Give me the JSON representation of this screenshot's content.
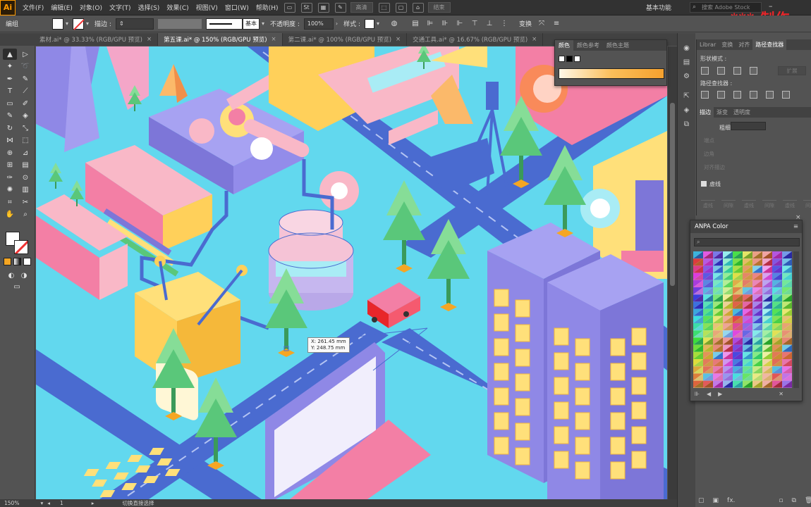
{
  "app": {
    "logo": "Ai"
  },
  "menu": [
    "文件(F)",
    "编辑(E)",
    "对象(O)",
    "文字(T)",
    "选择(S)",
    "效果(C)",
    "视图(V)",
    "窗口(W)",
    "帮助(H)"
  ],
  "menubar_buttons": {
    "st_icon": "St",
    "clear_label": "高清",
    "end_label": "结束"
  },
  "workspace": "基本功能",
  "search_stock_placeholder": "搜索 Adobe Stock",
  "watermark": "*** 制作",
  "control": {
    "group_label": "编组",
    "stroke_label": "描边 :",
    "stroke_style": "基本",
    "opacity_label": "不透明度 :",
    "opacity_value": "100%",
    "style_label": "样式 :",
    "transform_label": "变换"
  },
  "tabs": [
    {
      "label": "素材.ai* @ 33.33% (RGB/GPU 预览)",
      "active": false
    },
    {
      "label": "第五课.ai* @ 150% (RGB/GPU 预览)",
      "active": true
    },
    {
      "label": "第二课.ai* @ 100% (RGB/GPU 预览)",
      "active": false
    },
    {
      "label": "交通工具.ai* @ 16.67% (RGB/GPU 预览)",
      "active": false
    }
  ],
  "readout": {
    "x": "X: 261.45 mm",
    "y": "Y: 248.75 mm"
  },
  "status": {
    "zoom": "150%",
    "page": "1",
    "mode": "切换直接选择"
  },
  "color_panel": {
    "tabs": [
      "颜色",
      "颜色参考",
      "颜色主题"
    ]
  },
  "pathfinder_panel": {
    "tabs": [
      "Librar",
      "变换",
      "对齐",
      "路径查找器"
    ],
    "shape_modes": "形状模式 :",
    "pathfinders": "路径查找器 :",
    "expand": "扩展"
  },
  "stroke_panel": {
    "tabs": [
      "描边",
      "渐变",
      "透明度"
    ],
    "weight_label": "粗细 :",
    "cap_label": "端点",
    "corner_label": "边角",
    "align_label": "对齐描边",
    "dashed_label": "虚线",
    "dash_fields": [
      "虚线",
      "间隙",
      "虚线",
      "间隙",
      "虚线",
      "间隙"
    ]
  },
  "anpa": {
    "title": "ANPA Color"
  },
  "colors": {
    "cyan_bg": "#62d8ee",
    "road": "#4a6bd0",
    "purple_bldg": "#8f88e6",
    "window_yellow": "#ffe07a",
    "tree_green": "#5ac77a",
    "pink": "#f37fa5",
    "accent_red": "#e8262a"
  }
}
